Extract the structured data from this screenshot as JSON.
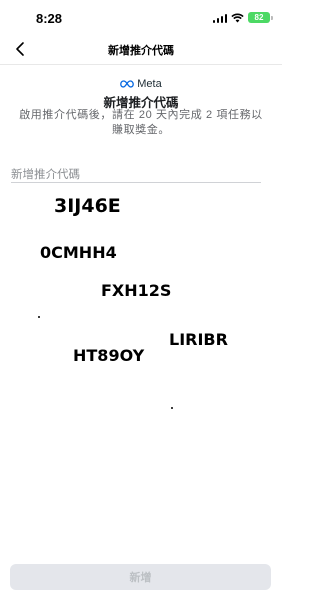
{
  "status_bar": {
    "time": "8:28",
    "battery": "82"
  },
  "nav": {
    "title": "新增推介代碼"
  },
  "content": {
    "brand": "Meta",
    "title": "新增推介代碼",
    "description": "啟用推介代碼後，請在 20 天內完成 2 項任務以賺取獎金。"
  },
  "field": {
    "label": "新增推介代碼"
  },
  "captcha_codes": [
    "3IJ46E",
    "0CMHH4",
    "FXH12S",
    "LIRIBR",
    "HT89OY"
  ],
  "actions": {
    "add_label": "新增"
  },
  "colors": {
    "battery": "#4cd964",
    "button_bg": "#e4e6eb",
    "button_text": "#bcc0c4",
    "meta_blue": "#0668e1"
  }
}
